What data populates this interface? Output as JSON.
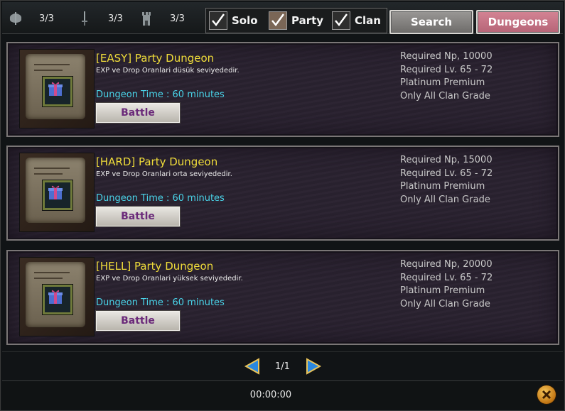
{
  "counters": [
    {
      "icon": "axe-icon",
      "value": "3/3"
    },
    {
      "icon": "sword-icon",
      "value": "3/3"
    },
    {
      "icon": "tower-icon",
      "value": "3/3"
    }
  ],
  "filters": [
    {
      "label": "Solo",
      "checked": true
    },
    {
      "label": "Party",
      "checked": true
    },
    {
      "label": "Clan",
      "checked": true
    }
  ],
  "buttons": {
    "search": "Search",
    "dungeons": "Dungeons"
  },
  "dungeons": [
    {
      "title": "[EASY] Party Dungeon",
      "description": "EXP ve Drop Oranlari düsük seviyededir.",
      "time": "Dungeon Time : 60 minutes",
      "battle_label": "Battle",
      "requirements": [
        "Required Np, 10000",
        "Required Lv. 65 - 72",
        "Platinum Premium",
        "Only All Clan Grade"
      ]
    },
    {
      "title": "[HARD] Party Dungeon",
      "description": "EXP ve Drop Oranlari orta seviyededir.",
      "time": "Dungeon Time : 60 minutes",
      "battle_label": "Battle",
      "requirements": [
        "Required Np, 15000",
        "Required Lv. 65 - 72",
        "Platinum Premium",
        "Only All Clan Grade"
      ]
    },
    {
      "title": "[HELL] Party Dungeon",
      "description": "EXP ve Drop Oranlari yüksek seviyededir.",
      "time": "Dungeon Time : 60 minutes",
      "battle_label": "Battle",
      "requirements": [
        "Required Np, 20000",
        "Required Lv. 65 - 72",
        "Platinum Premium",
        "Only All Clan Grade"
      ]
    }
  ],
  "pagination": {
    "label": "1/1",
    "prev_icon": "arrow-left-icon",
    "next_icon": "arrow-right-icon"
  },
  "timer": "00:00:00",
  "colors": {
    "title": "#f0dd3a",
    "time": "#49d3e8",
    "battle_text": "#6b2a7a",
    "dungeons_button": "#c36e80"
  }
}
